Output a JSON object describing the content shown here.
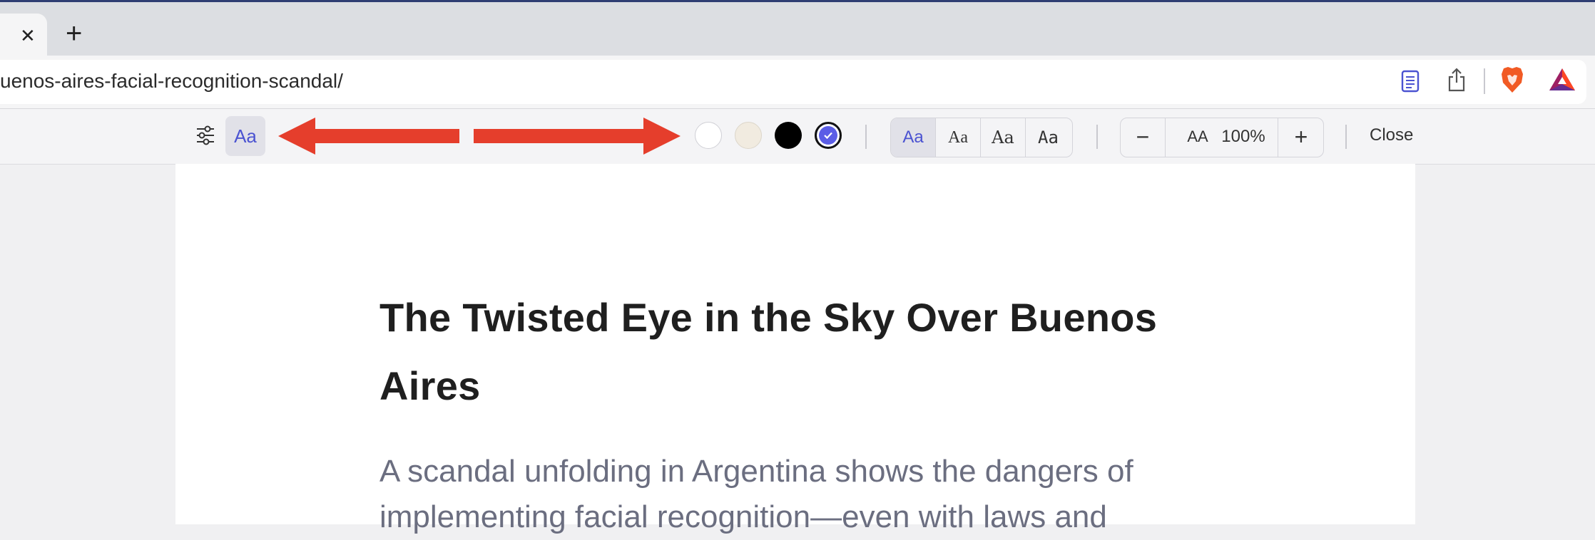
{
  "tabs": {
    "close_symbol": "✕",
    "new_tab_symbol": "+"
  },
  "address_bar": {
    "url_visible": "uenos-aires-facial-recognition-scandal/"
  },
  "toolbar_icons": [
    "reader-mode-icon",
    "share-icon",
    "brave-shields-icon",
    "brave-rewards-icon"
  ],
  "reader_toolbar": {
    "appearance_label": "Aa",
    "theme_swatches": [
      {
        "name": "white",
        "color": "#ffffff",
        "selected": false
      },
      {
        "name": "sepia",
        "color": "#f1ebe0",
        "selected": false
      },
      {
        "name": "dark",
        "color": "#000000",
        "selected": false
      },
      {
        "name": "system",
        "color": "#5b5de6",
        "selected": true
      }
    ],
    "font_options": [
      "Aa",
      "Aa",
      "Aa",
      "Aa"
    ],
    "selected_font_index": 0,
    "zoom": {
      "minus": "−",
      "size_icon": "AA",
      "value": "100%",
      "plus": "+"
    },
    "close_label": "Close"
  },
  "article": {
    "title": "The Twisted Eye in the Sky Over Buenos Aires",
    "subtitle": "A scandal unfolding in Argentina shows the dangers of implementing facial recognition—even with laws and"
  },
  "colors": {
    "accent": "#4b53d1",
    "annotation_arrow": "#e53e2c"
  }
}
